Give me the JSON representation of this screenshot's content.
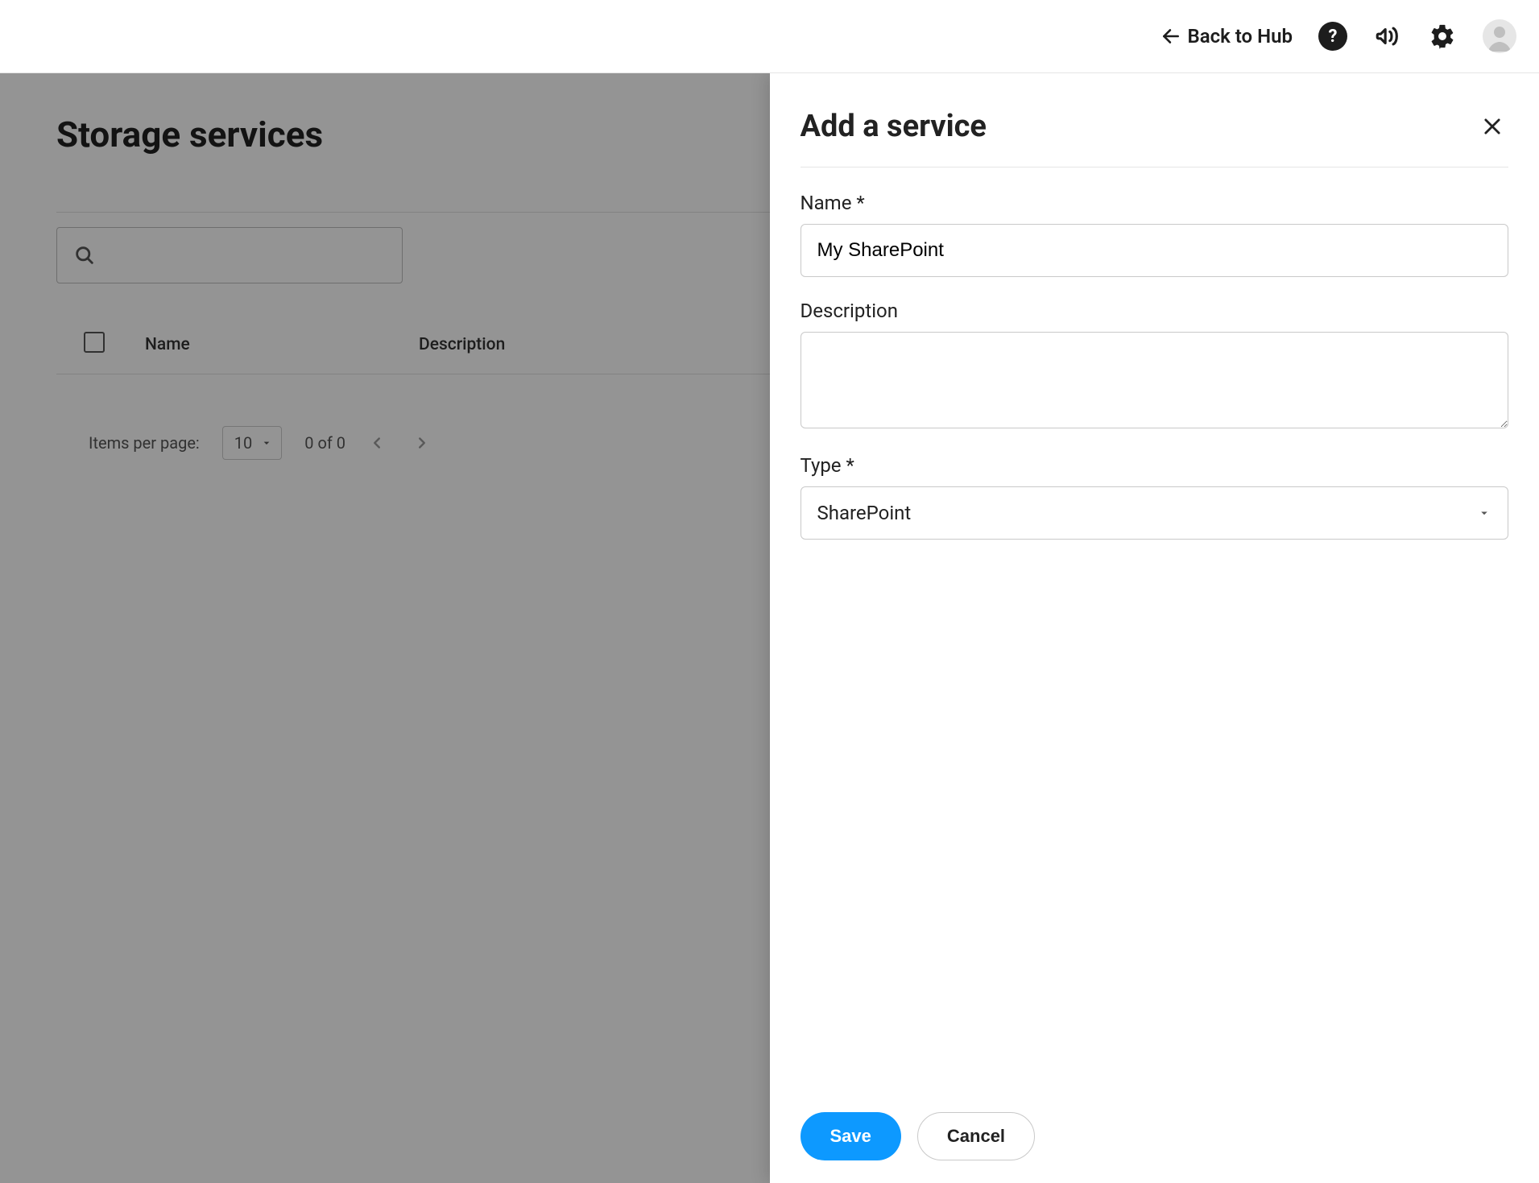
{
  "header": {
    "back_label": "Back to Hub"
  },
  "page": {
    "title": "Storage services",
    "search_value": "",
    "columns": {
      "name": "Name",
      "description": "Description"
    },
    "pager": {
      "items_label": "Items per page:",
      "page_size": "10",
      "range": "0 of 0"
    }
  },
  "panel": {
    "title": "Add a service",
    "fields": {
      "name_label": "Name *",
      "name_value": "My SharePoint",
      "description_label": "Description",
      "description_value": "",
      "type_label": "Type *",
      "type_value": "SharePoint"
    },
    "buttons": {
      "save": "Save",
      "cancel": "Cancel"
    }
  }
}
